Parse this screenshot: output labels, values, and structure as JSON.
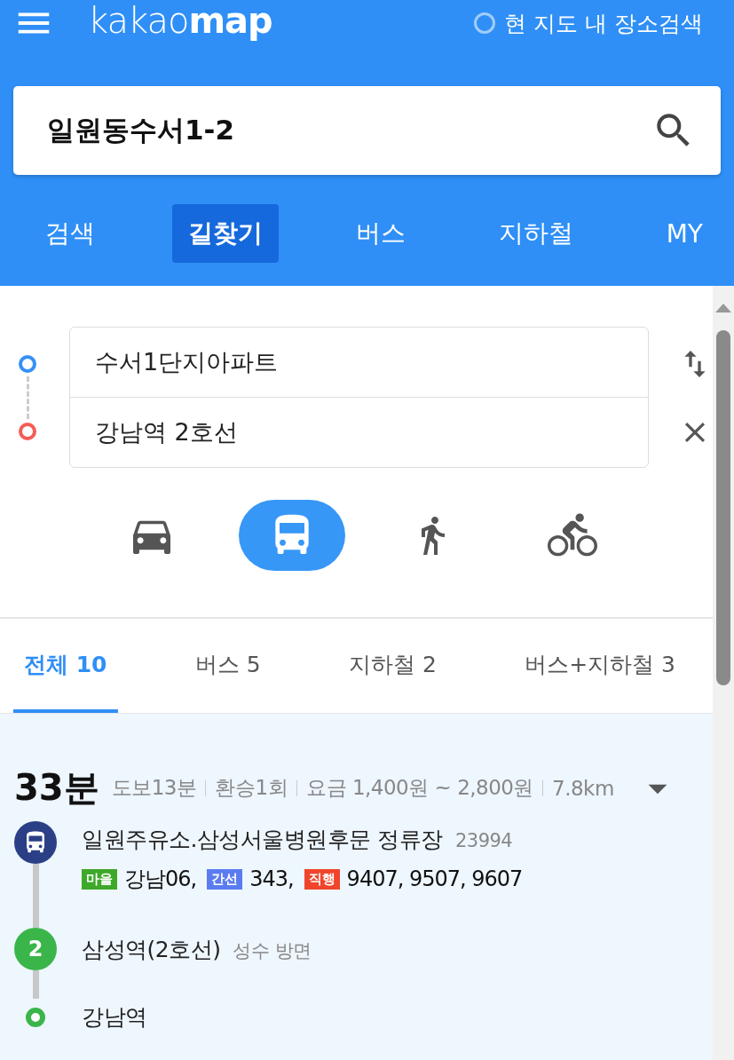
{
  "header": {
    "logo": {
      "light": "kakao",
      "bold": "map"
    },
    "map_search": {
      "label": "현 지도 내 장소검색",
      "checked": false
    }
  },
  "search": {
    "value": "일원동수서1-2"
  },
  "nav_tabs": [
    {
      "label": "검색",
      "selected": false
    },
    {
      "label": "길찾기",
      "selected": true
    },
    {
      "label": "버스",
      "selected": false
    },
    {
      "label": "지하철",
      "selected": false
    },
    {
      "label": "MY",
      "selected": false
    }
  ],
  "route_form": {
    "origin": "수서1단지아파트",
    "destination": "강남역 2호선"
  },
  "modes": [
    {
      "kind": "car",
      "selected": false
    },
    {
      "kind": "transit",
      "selected": true
    },
    {
      "kind": "walk",
      "selected": false
    },
    {
      "kind": "bike",
      "selected": false
    }
  ],
  "result_tabs": [
    {
      "label": "전체",
      "count": "10",
      "selected": true
    },
    {
      "label": "버스",
      "count": "5",
      "selected": false
    },
    {
      "label": "지하철",
      "count": "2",
      "selected": false
    },
    {
      "label": "버스+지하철",
      "count": "3",
      "selected": false
    }
  ],
  "route": {
    "duration": "33분",
    "summary": [
      "도보13분",
      "환승1회",
      "요금 1,400원 ~ 2,800원",
      "7.8km"
    ],
    "expanded": false,
    "steps": [
      {
        "kind": "bus",
        "name": "일원주유소.삼성서울병원후문 정류장",
        "stop_id": "23994",
        "lines": [
          {
            "type": "마을",
            "color": "#3ea82a",
            "routes": "강남06,"
          },
          {
            "type": "간선",
            "color": "#5b7cf0",
            "routes": "343,"
          },
          {
            "type": "직행",
            "color": "#f0452b",
            "routes": "9407, 9507, 9607"
          }
        ]
      },
      {
        "kind": "subway",
        "badge": "2",
        "color": "#3ab54a",
        "name": "삼성역(2호선)",
        "direction": "성수 방면"
      },
      {
        "kind": "end",
        "color": "#3ab54a",
        "name": "강남역"
      }
    ]
  }
}
